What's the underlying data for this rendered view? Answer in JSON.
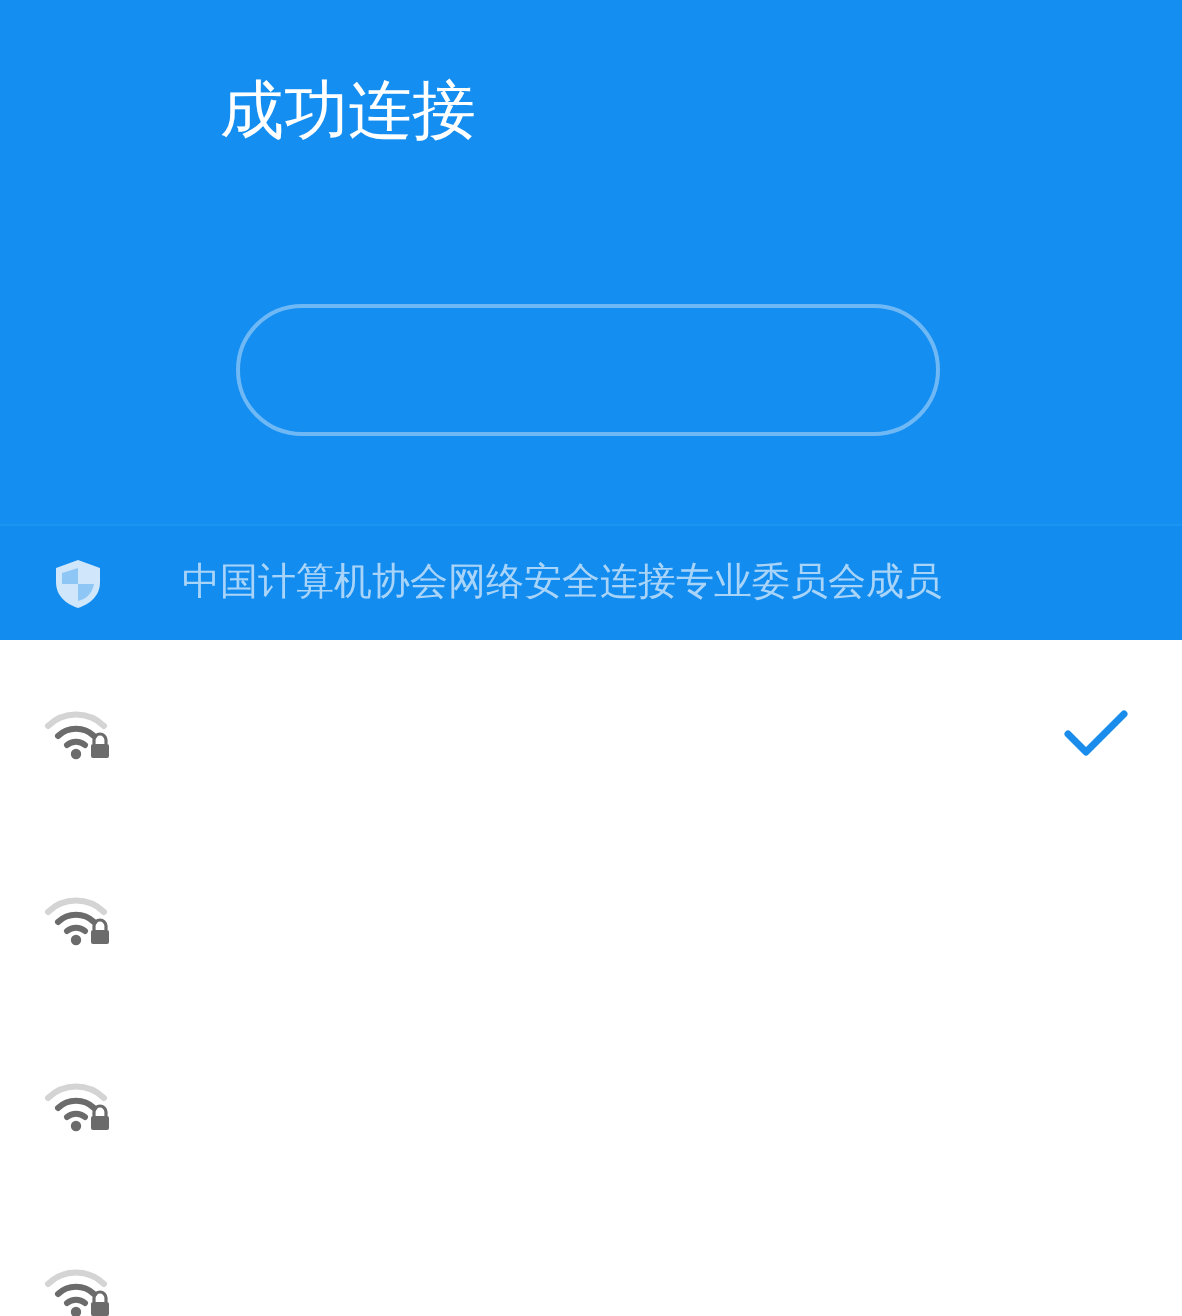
{
  "header": {
    "title": "成功连接"
  },
  "banner": {
    "text": "中国计算机协会网络安全连接专业委员会成员"
  },
  "networks": [
    {
      "selected": true
    },
    {
      "selected": false
    },
    {
      "selected": false
    },
    {
      "selected": false
    }
  ]
}
